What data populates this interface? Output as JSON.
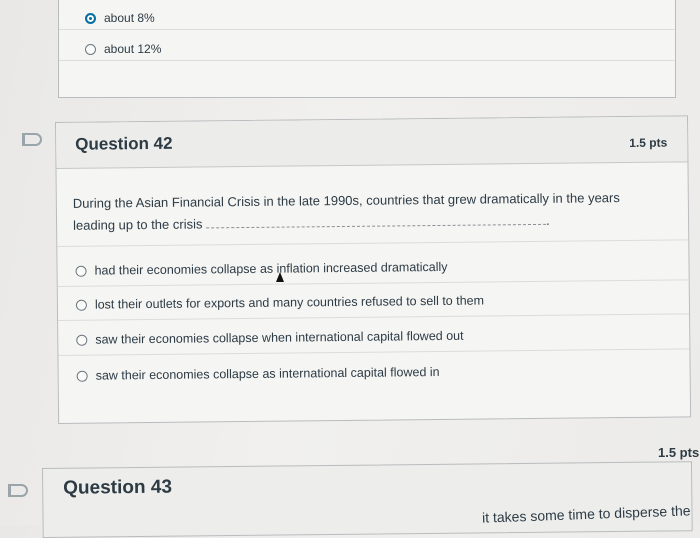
{
  "previous_question": {
    "options": [
      {
        "label": "about 8%",
        "selected": true
      },
      {
        "label": "about 12%",
        "selected": false
      }
    ]
  },
  "question_42": {
    "title": "Question 42",
    "points": "1.5 pts",
    "text_line1": "During the Asian Financial Crisis in the late 1990s, countries that grew dramatically in the years",
    "text_line2": "leading up to the crisis",
    "blank_end": ".",
    "options": [
      {
        "label": "had their economies collapse as inflation increased dramatically",
        "selected": false
      },
      {
        "label": "lost their outlets for exports and many countries refused to sell to them",
        "selected": false
      },
      {
        "label": "saw their economies collapse when international capital flowed out",
        "selected": false
      },
      {
        "label": "saw their economies collapse as international capital flowed in",
        "selected": false
      }
    ]
  },
  "question_43": {
    "title": "Question 43",
    "points": "1.5 pts",
    "text_snippet": "it takes some time to disperse the"
  },
  "colors": {
    "accent": "#0770a3",
    "text": "#2d3b45",
    "flag": "#9aa4ab"
  },
  "icons": [
    "bookmark-flag-icon",
    "radio-button-icon",
    "mouse-cursor-icon"
  ]
}
